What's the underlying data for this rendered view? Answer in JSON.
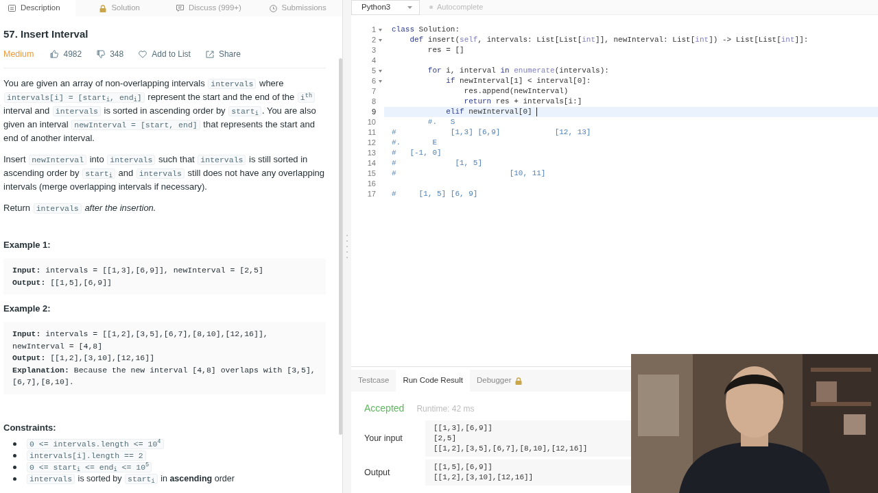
{
  "problem_tabs": [
    {
      "label": "Description",
      "selected": true
    },
    {
      "label": "Solution",
      "selected": false
    },
    {
      "label": "Discuss (999+)",
      "selected": false
    },
    {
      "label": "Submissions",
      "selected": false
    }
  ],
  "problem": {
    "title": "57. Insert Interval",
    "difficulty": "Medium",
    "likes": "4982",
    "dislikes": "348",
    "add_to_list": "Add to List",
    "share": "Share",
    "paragraphs": [
      [
        {
          "text": "You are given an array of non-overlapping intervals ",
          "kind": "text"
        },
        {
          "text": "intervals",
          "kind": "code"
        },
        {
          "text": " where ",
          "kind": "text"
        },
        {
          "text": "intervals[i] = [start$_{i}$, end$_{i}$]",
          "kind": "code"
        },
        {
          "text": " represent the start and the end of the ",
          "kind": "text"
        },
        {
          "text": "i$^{th}$",
          "kind": "code"
        },
        {
          "text": " interval and ",
          "kind": "text"
        },
        {
          "text": "intervals",
          "kind": "code"
        },
        {
          "text": " is sorted in ascending order by ",
          "kind": "text"
        },
        {
          "text": "start$_{i}$",
          "kind": "code"
        },
        {
          "text": ". You are also given an interval ",
          "kind": "text"
        },
        {
          "text": "newInterval = [start, end]",
          "kind": "code"
        },
        {
          "text": " that represents the start and end of another interval.",
          "kind": "text"
        }
      ],
      [
        {
          "text": "Insert ",
          "kind": "text"
        },
        {
          "text": "newInterval",
          "kind": "code"
        },
        {
          "text": " into ",
          "kind": "text"
        },
        {
          "text": "intervals",
          "kind": "code"
        },
        {
          "text": " such that ",
          "kind": "text"
        },
        {
          "text": "intervals",
          "kind": "code"
        },
        {
          "text": " is still sorted in ascending order by ",
          "kind": "text"
        },
        {
          "text": "start$_{i}$",
          "kind": "code"
        },
        {
          "text": " and ",
          "kind": "text"
        },
        {
          "text": "intervals",
          "kind": "code"
        },
        {
          "text": " still does not have any overlapping intervals (merge overlapping intervals if necessary).",
          "kind": "text"
        }
      ],
      [
        {
          "text": "Return ",
          "kind": "text"
        },
        {
          "text": "intervals",
          "kind": "code"
        },
        {
          "text": " *after the insertion.*",
          "kind": "text"
        }
      ]
    ],
    "examples": [
      {
        "title": "Example 1:",
        "lines": [
          {
            "label": "Input:",
            "value": "intervals = [[1,3],[6,9]], newInterval = [2,5]"
          },
          {
            "label": "Output:",
            "value": "[[1,5],[6,9]]"
          }
        ]
      },
      {
        "title": "Example 2:",
        "lines": [
          {
            "label": "Input:",
            "value": "intervals = [[1,2],[3,5],[6,7],[8,10],[12,16]],"
          },
          {
            "value": "newInterval = [4,8]"
          },
          {
            "label": "Output:",
            "value": "[[1,2],[3,10],[12,16]]"
          },
          {
            "label": "Explanation:",
            "value": "Because the new interval [4,8] overlaps with [3,5],"
          },
          {
            "value": "[6,7],[8,10]."
          }
        ]
      }
    ],
    "constraints_title": "Constraints:",
    "constraints": [
      [
        {
          "text": "0 <= intervals.length <= 10$^{4}$",
          "kind": "code"
        }
      ],
      [
        {
          "text": "intervals[i].length == 2",
          "kind": "code"
        }
      ],
      [
        {
          "text": "0 <= start$_{i}$ <= end$_{i}$ <= 10$^{5}$",
          "kind": "code"
        }
      ],
      [
        {
          "text": "intervals",
          "kind": "code"
        },
        {
          "text": " is sorted by ",
          "kind": "text"
        },
        {
          "text": "start$_{i}$",
          "kind": "code"
        },
        {
          "text": " in **ascending** order",
          "kind": "text"
        }
      ]
    ]
  },
  "editor": {
    "language": "Python3",
    "autocomplete": {
      "label": "Autocomplete",
      "on": false
    },
    "lines": [
      {
        "number": "1",
        "foldable": true,
        "active": false,
        "segments": [
          {
            "text": "class",
            "kind": "kw"
          },
          {
            "text": " Solution:",
            "kind": "plain"
          }
        ]
      },
      {
        "number": "2",
        "foldable": true,
        "active": false,
        "segments": [
          {
            "text": "    def",
            "kind": "kw"
          },
          {
            "text": " insert(",
            "kind": "plain"
          },
          {
            "text": "self",
            "kind": "builtin"
          },
          {
            "text": ", intervals: List[List[",
            "kind": "plain"
          },
          {
            "text": "int",
            "kind": "builtin"
          },
          {
            "text": "]], newInterval: List[",
            "kind": "plain"
          },
          {
            "text": "int",
            "kind": "builtin"
          },
          {
            "text": "]) -> List[List[",
            "kind": "plain"
          },
          {
            "text": "int",
            "kind": "builtin"
          },
          {
            "text": "]]:",
            "kind": "plain"
          }
        ]
      },
      {
        "number": "3",
        "foldable": false,
        "active": false,
        "segments": [
          {
            "text": "        res = []",
            "kind": "plain"
          }
        ]
      },
      {
        "number": "4",
        "foldable": false,
        "active": false
      },
      {
        "number": "5",
        "foldable": true,
        "active": false,
        "segments": [
          {
            "text": "        for",
            "kind": "kw"
          },
          {
            "text": " i, interval ",
            "kind": "plain"
          },
          {
            "text": "in ",
            "kind": "kw"
          },
          {
            "text": "enumerate",
            "kind": "builtin"
          },
          {
            "text": "(intervals):",
            "kind": "plain"
          }
        ]
      },
      {
        "number": "6",
        "foldable": true,
        "active": false,
        "segments": [
          {
            "text": "            if",
            "kind": "kw"
          },
          {
            "text": " newInterval[1] < interval[0]:",
            "kind": "plain"
          }
        ]
      },
      {
        "number": "7",
        "foldable": false,
        "active": false,
        "segments": [
          {
            "text": "                res.append(newInterval)",
            "kind": "plain"
          }
        ]
      },
      {
        "number": "8",
        "foldable": false,
        "active": false,
        "segments": [
          {
            "text": "                return",
            "kind": "kw"
          },
          {
            "text": " res + intervals[i:]",
            "kind": "plain"
          }
        ]
      },
      {
        "number": "9",
        "foldable": false,
        "active": true,
        "segments": [
          {
            "text": "            elif",
            "kind": "kw"
          },
          {
            "text": " newInterval[0] ",
            "kind": "plain"
          }
        ]
      },
      {
        "number": "10",
        "foldable": false,
        "active": false,
        "segments": [
          {
            "text": "        #.   S",
            "kind": "comment"
          }
        ]
      },
      {
        "number": "11",
        "foldable": false,
        "active": false,
        "segments": [
          {
            "text": "#            [1,3] [6,9]            [12, 13]",
            "kind": "comment"
          }
        ]
      },
      {
        "number": "12",
        "foldable": false,
        "active": false,
        "segments": [
          {
            "text": "#.       E",
            "kind": "comment"
          }
        ]
      },
      {
        "number": "13",
        "foldable": false,
        "active": false,
        "segments": [
          {
            "text": "#   [-1, 0]",
            "kind": "comment"
          }
        ]
      },
      {
        "number": "14",
        "foldable": false,
        "active": false,
        "segments": [
          {
            "text": "#             [1, 5]",
            "kind": "comment"
          }
        ]
      },
      {
        "number": "15",
        "foldable": false,
        "active": false,
        "segments": [
          {
            "text": "#                         [10, 11]",
            "kind": "comment"
          }
        ]
      },
      {
        "number": "16",
        "foldable": false,
        "active": false
      },
      {
        "number": "17",
        "foldable": false,
        "active": false,
        "segments": [
          {
            "text": "#     [1, 5] [6, 9]",
            "kind": "comment"
          }
        ]
      }
    ]
  },
  "result_tabs": [
    {
      "label": "Testcase",
      "locked": false,
      "selected": false
    },
    {
      "label": "Run Code Result",
      "locked": false,
      "selected": true
    },
    {
      "label": "Debugger",
      "locked": true,
      "selected": false
    }
  ],
  "result": {
    "status": "Accepted",
    "runtime": "Runtime: 42 ms",
    "rows": [
      {
        "label": "Your input",
        "lines": [
          "[[1,3],[6,9]]",
          "[2,5]",
          "[[1,2],[3,5],[6,7],[8,10],[12,16]]"
        ]
      },
      {
        "label": "Output",
        "lines": [
          "[[1,5],[6,9]]",
          "[[1,2],[3,10],[12,16]]"
        ]
      }
    ]
  }
}
